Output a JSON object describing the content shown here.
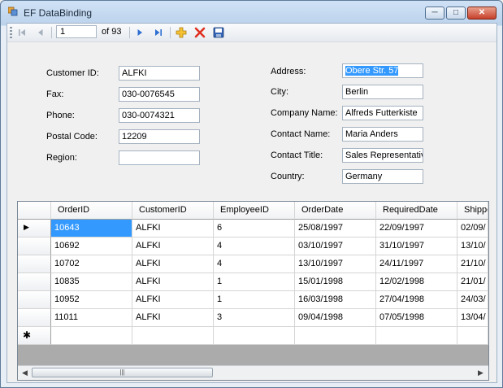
{
  "window": {
    "title": "EF DataBinding"
  },
  "caption_buttons": {
    "minimize": "─",
    "maximize": "□",
    "close": "✕"
  },
  "navigator": {
    "position": "1",
    "count_label": "of 93",
    "icons": [
      "move-first-icon",
      "move-previous-icon",
      "move-next-icon",
      "move-last-icon",
      "add-new-icon",
      "delete-icon",
      "save-icon"
    ]
  },
  "form": {
    "left": [
      {
        "label": "Customer ID:",
        "value": "ALFKI"
      },
      {
        "label": "Fax:",
        "value": "030-0076545"
      },
      {
        "label": "Phone:",
        "value": "030-0074321"
      },
      {
        "label": "Postal Code:",
        "value": "12209"
      },
      {
        "label": "Region:",
        "value": ""
      }
    ],
    "right": [
      {
        "label": "Address:",
        "value": "Obere Str. 57"
      },
      {
        "label": "City:",
        "value": "Berlin"
      },
      {
        "label": "Company Name:",
        "value": "Alfreds Futterkiste"
      },
      {
        "label": "Contact Name:",
        "value": "Maria Anders"
      },
      {
        "label": "Contact Title:",
        "value": "Sales Representativ"
      },
      {
        "label": "Country:",
        "value": "Germany"
      }
    ]
  },
  "grid": {
    "columns": [
      "OrderID",
      "CustomerID",
      "EmployeeID",
      "OrderDate",
      "RequiredDate",
      "Shippe"
    ],
    "rows": [
      [
        "10643",
        "ALFKI",
        "6",
        "25/08/1997",
        "22/09/1997",
        "02/09/"
      ],
      [
        "10692",
        "ALFKI",
        "4",
        "03/10/1997",
        "31/10/1997",
        "13/10/"
      ],
      [
        "10702",
        "ALFKI",
        "4",
        "13/10/1997",
        "24/11/1997",
        "21/10/"
      ],
      [
        "10835",
        "ALFKI",
        "1",
        "15/01/1998",
        "12/02/1998",
        "21/01/"
      ],
      [
        "10952",
        "ALFKI",
        "1",
        "16/03/1998",
        "27/04/1998",
        "24/03/"
      ],
      [
        "11011",
        "ALFKI",
        "3",
        "09/04/1998",
        "07/05/1998",
        "13/04/"
      ]
    ],
    "current_row_marker": "▶",
    "new_row_marker": "✱",
    "scroll_left": "◀",
    "scroll_right": "▶",
    "thumb_grip": "|||"
  }
}
